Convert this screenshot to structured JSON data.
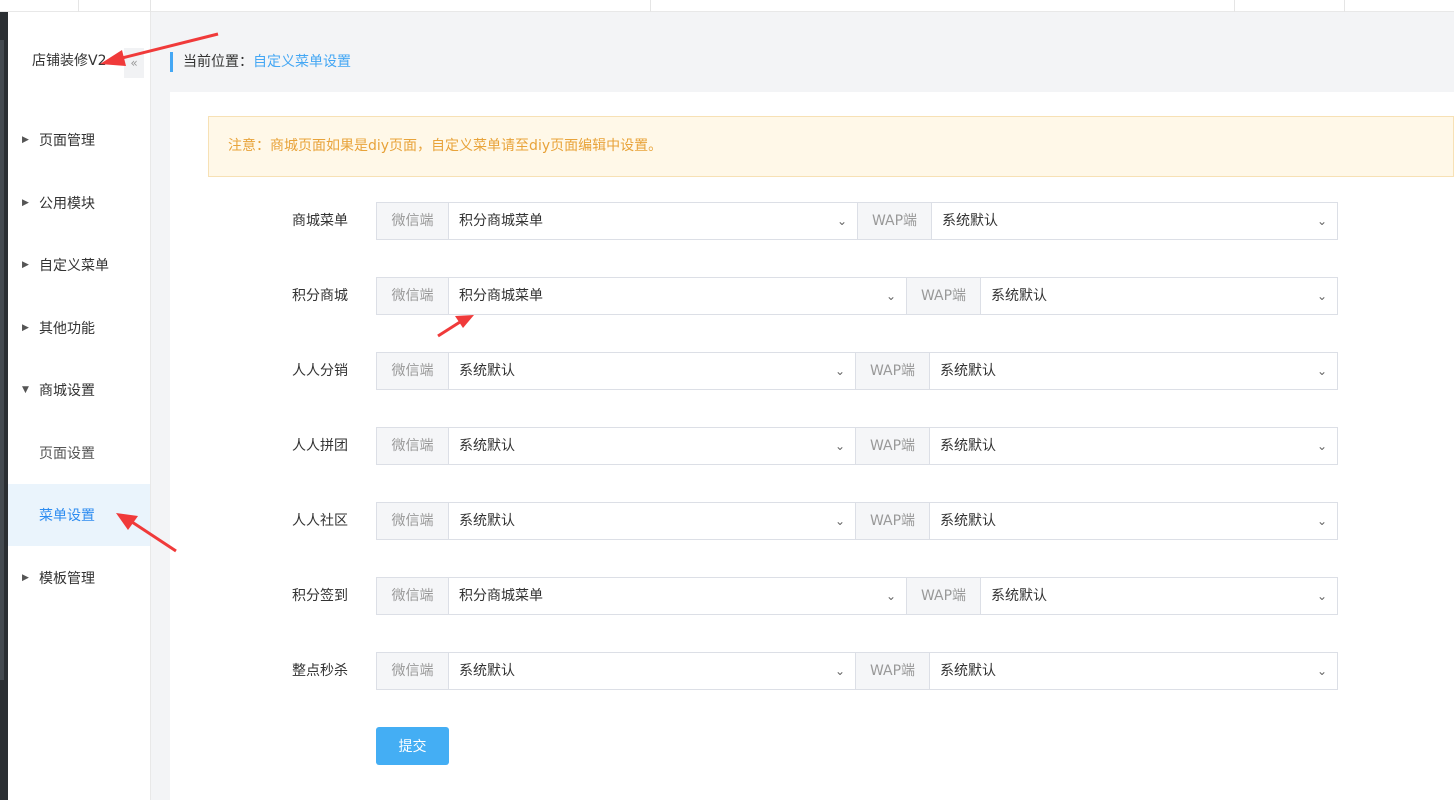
{
  "sidebar": {
    "title": "店铺装修V2",
    "collapse_icon": "«",
    "items": [
      {
        "label": "页面管理",
        "caret": "▶"
      },
      {
        "label": "公用模块",
        "caret": "▶"
      },
      {
        "label": "自定义菜单",
        "caret": "▶"
      },
      {
        "label": "其他功能",
        "caret": "▶"
      },
      {
        "label": "商城设置",
        "caret": "▼"
      },
      {
        "label": "页面设置"
      },
      {
        "label": "菜单设置"
      },
      {
        "label": "模板管理",
        "caret": "▶"
      }
    ]
  },
  "breadcrumb": {
    "prefix": "当前位置：",
    "current": "自定义菜单设置"
  },
  "notice": "注意：商城页面如果是diy页面，自定义菜单请至diy页面编辑中设置。",
  "addon": {
    "wechat": "微信端",
    "wap": "WAP端"
  },
  "chevron": "⌄",
  "rows": [
    {
      "label": "商城菜单",
      "wechat": "积分商城菜单",
      "wap": "系统默认"
    },
    {
      "label": "积分商城",
      "wechat": "积分商城菜单",
      "wap": "系统默认"
    },
    {
      "label": "人人分销",
      "wechat": "系统默认",
      "wap": "系统默认"
    },
    {
      "label": "人人拼团",
      "wechat": "系统默认",
      "wap": "系统默认"
    },
    {
      "label": "人人社区",
      "wechat": "系统默认",
      "wap": "系统默认"
    },
    {
      "label": "积分签到",
      "wechat": "积分商城菜单",
      "wap": "系统默认"
    },
    {
      "label": "整点秒杀",
      "wechat": "系统默认",
      "wap": "系统默认"
    }
  ],
  "submit_label": "提交",
  "colors": {
    "accent": "#44aef4",
    "notice_text": "#e8a33a",
    "annotation_arrow": "#f03a3a"
  }
}
